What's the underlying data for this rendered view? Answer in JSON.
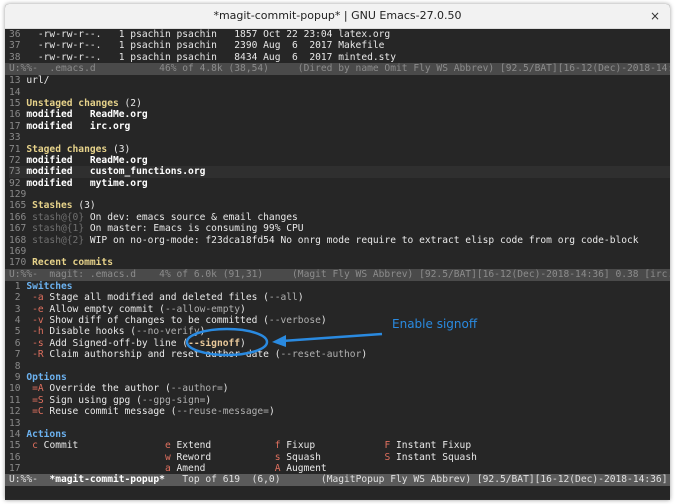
{
  "window": {
    "title": "*magit-commit-popup* | GNU Emacs-27.0.50",
    "close_label": "×"
  },
  "colors": {
    "background": "#262626",
    "heading": "#e6d28a",
    "section": "#6cb2f0",
    "key": "#e0705f",
    "annotation": "#2a8ae0"
  },
  "top_pane": {
    "lines": [
      [
        {
          "t": "36 ",
          "c": "num"
        },
        {
          "t": "  -rw-rw-r--.   1 psachin psachin   1857 Oct 22 23:04 latex.org",
          "c": ""
        }
      ],
      [
        {
          "t": "37 ",
          "c": "num"
        },
        {
          "t": "  -rw-rw-r--.   1 psachin psachin   2390 Aug  6  2017 Makefile",
          "c": ""
        }
      ],
      [
        {
          "t": "38 ",
          "c": "num"
        },
        {
          "t": "  -rw-rw-r--.   1 psachin psachin   8434 Aug  6  2017 minted.sty",
          "c": ""
        }
      ]
    ],
    "modeline": "U:%%-  .emacs.d           46% of 4.8k (38,54)     (Dired by name Omit Fly WS Abbrev) [92.5/BAT][16-12(Dec)-2018-14:36]"
  },
  "middle_pane": {
    "lines": [
      [
        {
          "t": "13 ",
          "c": "num"
        },
        {
          "t": "url/",
          "c": ""
        }
      ],
      [
        {
          "t": "14",
          "c": "num"
        }
      ],
      [
        {
          "t": "15 ",
          "c": "num"
        },
        {
          "t": "Unstaged changes",
          "c": "yel"
        },
        {
          "t": " (2)",
          "c": ""
        }
      ],
      [
        {
          "t": "16 ",
          "c": "num"
        },
        {
          "t": "modified   ReadMe.org",
          "c": "bold"
        }
      ],
      [
        {
          "t": "17 ",
          "c": "num"
        },
        {
          "t": "modified   irc.org",
          "c": "bold"
        }
      ],
      [
        {
          "t": "33",
          "c": "num"
        }
      ],
      [
        {
          "t": "71 ",
          "c": "num"
        },
        {
          "t": "Staged changes",
          "c": "yel"
        },
        {
          "t": " (3)",
          "c": ""
        }
      ],
      [
        {
          "t": "72 ",
          "c": "num"
        },
        {
          "t": "modified   ReadMe.org",
          "c": "bold"
        }
      ],
      [
        {
          "t": "73 ",
          "c": "num"
        },
        {
          "t": "modified   custom_functions.org",
          "c": "bold"
        }
      ],
      [
        {
          "t": "92 ",
          "c": "num"
        },
        {
          "t": "modified   mytime.org",
          "c": "bold"
        }
      ],
      [
        {
          "t": "129",
          "c": "num"
        }
      ],
      [
        {
          "t": "165 ",
          "c": "num"
        },
        {
          "t": "Stashes",
          "c": "yel"
        },
        {
          "t": " (3)",
          "c": ""
        }
      ],
      [
        {
          "t": "166 ",
          "c": "num"
        },
        {
          "t": "stash@{0}",
          "c": "dim"
        },
        {
          "t": " On dev: emacs source & email changes",
          "c": ""
        }
      ],
      [
        {
          "t": "167 ",
          "c": "num"
        },
        {
          "t": "stash@{1}",
          "c": "dim"
        },
        {
          "t": " On master: Emacs is consuming 99% CPU",
          "c": ""
        }
      ],
      [
        {
          "t": "168 ",
          "c": "num"
        },
        {
          "t": "stash@{2}",
          "c": "dim"
        },
        {
          "t": " WIP on no-org-mode: f23dca18fd54 No onrg mode require to extract elisp code from org code-block",
          "c": ""
        }
      ],
      [
        {
          "t": "169",
          "c": "num"
        }
      ],
      [
        {
          "t": "170 ",
          "c": "num"
        },
        {
          "t": "Recent commits",
          "c": "yel"
        }
      ]
    ],
    "modeline": "U:%%-  magit: .emacs.d    4% of 6.0k (91,31)     (Magit Fly WS Abbrev) [92.5/BAT][16-12(Dec)-2018-14:36] 0.38 [irc.o"
  },
  "popup_pane": {
    "lines": [
      [
        {
          "t": " 1 ",
          "c": "num"
        },
        {
          "t": "Switches",
          "c": "blue"
        }
      ],
      [
        {
          "t": " 2 ",
          "c": "num"
        },
        {
          "t": " -a",
          "c": "key"
        },
        {
          "t": " Stage all modified and deleted files (",
          "c": ""
        },
        {
          "t": "--all",
          "c": "flag"
        },
        {
          "t": ")",
          "c": ""
        }
      ],
      [
        {
          "t": " 3 ",
          "c": "num"
        },
        {
          "t": " -e",
          "c": "key"
        },
        {
          "t": " Allow empty commit (",
          "c": ""
        },
        {
          "t": "--allow-empty",
          "c": "flag"
        },
        {
          "t": ")",
          "c": ""
        }
      ],
      [
        {
          "t": " 4 ",
          "c": "num"
        },
        {
          "t": " -v",
          "c": "key"
        },
        {
          "t": " Show diff of changes to be committed (",
          "c": ""
        },
        {
          "t": "--verbose",
          "c": "flag"
        },
        {
          "t": ")",
          "c": ""
        }
      ],
      [
        {
          "t": " 5 ",
          "c": "num"
        },
        {
          "t": " -h",
          "c": "key"
        },
        {
          "t": " Disable hooks (",
          "c": ""
        },
        {
          "t": "--no-verify",
          "c": "flag"
        },
        {
          "t": ")",
          "c": ""
        }
      ],
      [
        {
          "t": " 6 ",
          "c": "num"
        },
        {
          "t": " -s",
          "c": "key"
        },
        {
          "t": " Add Signed-off-by line (",
          "c": ""
        },
        {
          "t": "--signoff",
          "c": "on"
        },
        {
          "t": ")",
          "c": ""
        }
      ],
      [
        {
          "t": " 7 ",
          "c": "num"
        },
        {
          "t": " -R",
          "c": "key"
        },
        {
          "t": " Claim authorship and reset author date (",
          "c": ""
        },
        {
          "t": "--reset-author",
          "c": "flag"
        },
        {
          "t": ")",
          "c": ""
        }
      ],
      [
        {
          "t": " 8",
          "c": "num"
        }
      ],
      [
        {
          "t": " 9 ",
          "c": "num"
        },
        {
          "t": "Options",
          "c": "blue"
        }
      ],
      [
        {
          "t": "10 ",
          "c": "num"
        },
        {
          "t": " =A",
          "c": "key"
        },
        {
          "t": " Override the author (",
          "c": ""
        },
        {
          "t": "--author=",
          "c": "flag"
        },
        {
          "t": ")",
          "c": ""
        }
      ],
      [
        {
          "t": "11 ",
          "c": "num"
        },
        {
          "t": " =S",
          "c": "key"
        },
        {
          "t": " Sign using gpg (",
          "c": ""
        },
        {
          "t": "--gpg-sign=",
          "c": "flag"
        },
        {
          "t": ")",
          "c": ""
        }
      ],
      [
        {
          "t": "12 ",
          "c": "num"
        },
        {
          "t": " =C",
          "c": "key"
        },
        {
          "t": " Reuse commit message (",
          "c": ""
        },
        {
          "t": "--reuse-message=",
          "c": "flag"
        },
        {
          "t": ")",
          "c": ""
        }
      ],
      [
        {
          "t": "13",
          "c": "num"
        }
      ],
      [
        {
          "t": "14 ",
          "c": "num"
        },
        {
          "t": "Actions",
          "c": "blue"
        }
      ],
      [
        {
          "t": "15 ",
          "c": "num"
        },
        {
          "t": " c",
          "c": "key"
        },
        {
          "t": " Commit               ",
          "c": ""
        },
        {
          "t": "e",
          "c": "key"
        },
        {
          "t": " Extend           ",
          "c": ""
        },
        {
          "t": "f",
          "c": "key"
        },
        {
          "t": " Fixup            ",
          "c": ""
        },
        {
          "t": "F",
          "c": "key"
        },
        {
          "t": " Instant Fixup",
          "c": ""
        }
      ],
      [
        {
          "t": "16 ",
          "c": "num"
        },
        {
          "t": "                        ",
          "c": ""
        },
        {
          "t": "w",
          "c": "key"
        },
        {
          "t": " Reword           ",
          "c": ""
        },
        {
          "t": "s",
          "c": "key"
        },
        {
          "t": " Squash           ",
          "c": ""
        },
        {
          "t": "S",
          "c": "key"
        },
        {
          "t": " Instant Squash",
          "c": ""
        }
      ],
      [
        {
          "t": "17 ",
          "c": "num"
        },
        {
          "t": "                        ",
          "c": ""
        },
        {
          "t": "a",
          "c": "key"
        },
        {
          "t": " Amend            ",
          "c": ""
        },
        {
          "t": "A",
          "c": "key"
        },
        {
          "t": " Augment",
          "c": ""
        }
      ]
    ],
    "modeline_prefix": "U:%%-  ",
    "modeline_buffer": "*magit-commit-popup*",
    "modeline_rest": "   Top of 619  (6,0)       (MagitPopup Fly WS Abbrev) [92.5/BAT][16-12(Dec)-2018-14:36] 0"
  },
  "annotation": {
    "label": "Enable signoff"
  }
}
